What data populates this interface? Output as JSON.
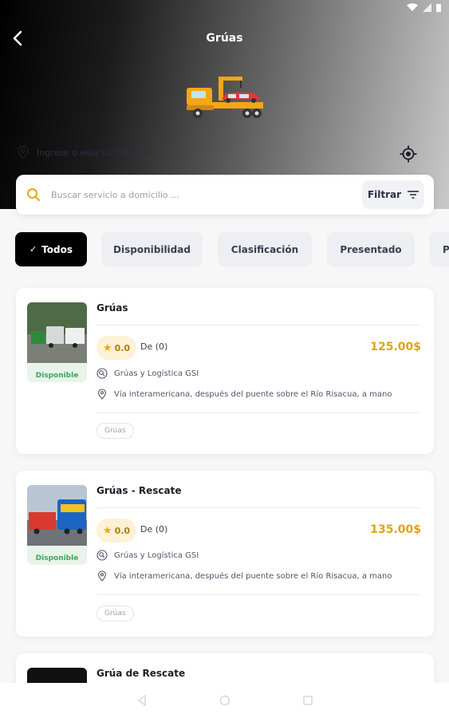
{
  "header": {
    "title": "Grúas",
    "address_placeholder": "Ingrese o elija su dirección"
  },
  "search": {
    "placeholder": "Buscar servicio a domicilio ...",
    "filter_label": "Filtrar"
  },
  "chips": [
    {
      "label": "Todos",
      "active": true
    },
    {
      "label": "Disponibilidad",
      "active": false
    },
    {
      "label": "Clasificación",
      "active": false
    },
    {
      "label": "Presentado",
      "active": false
    },
    {
      "label": "P",
      "active": false
    }
  ],
  "services": [
    {
      "name": "Grúas",
      "availability": "Disponible",
      "rating": "0.0",
      "reviews": "De (0)",
      "price": "125.00$",
      "provider": "Grúas y Logística GSI",
      "address": "Vía interamericana, después del puente sobre el Río Risacua, a mano",
      "tag": "Grúas"
    },
    {
      "name": "Grúas - Rescate",
      "availability": "Disponible",
      "rating": "0.0",
      "reviews": "De (0)",
      "price": "135.00$",
      "provider": "Grúas y Logística GSI",
      "address": "Vía interamericana, después del puente sobre el Río Risacua, a mano",
      "tag": "Grúas"
    },
    {
      "name": "Grúa de Rescate"
    }
  ],
  "colors": {
    "accent": "#e0a412",
    "available": "#3fa45b",
    "active_chip": "#000000"
  }
}
